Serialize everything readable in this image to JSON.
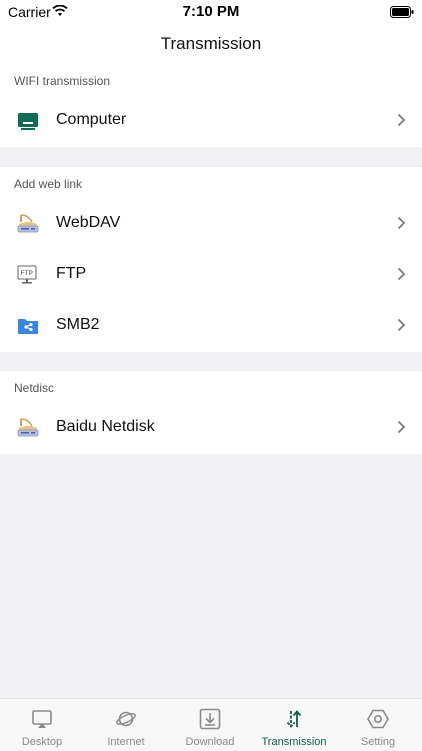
{
  "status": {
    "carrier": "Carrier",
    "time": "7:10 PM"
  },
  "header": {
    "title": "Transmission"
  },
  "sections": [
    {
      "title": "WIFI transmission",
      "items": [
        {
          "label": "Computer",
          "icon": "monitor-icon"
        }
      ]
    },
    {
      "title": "Add web link",
      "items": [
        {
          "label": "WebDAV",
          "icon": "webdav-router-icon"
        },
        {
          "label": "FTP",
          "icon": "ftp-icon"
        },
        {
          "label": "SMB2",
          "icon": "smb-folder-icon"
        }
      ]
    },
    {
      "title": "Netdisc",
      "items": [
        {
          "label": "Baidu Netdisk",
          "icon": "baidu-router-icon"
        }
      ]
    }
  ],
  "tabs": [
    {
      "label": "Desktop",
      "icon": "desktop-airplay-icon",
      "active": false
    },
    {
      "label": "Internet",
      "icon": "planet-icon",
      "active": false
    },
    {
      "label": "Download",
      "icon": "download-icon",
      "active": false
    },
    {
      "label": "Transmission",
      "icon": "transfer-arrows-icon",
      "active": true
    },
    {
      "label": "Setting",
      "icon": "hexagon-settings-icon",
      "active": false
    }
  ],
  "colors": {
    "accent": "#0f5d4c",
    "background": "#f2f2f4",
    "inactive": "#8a8a8a"
  }
}
